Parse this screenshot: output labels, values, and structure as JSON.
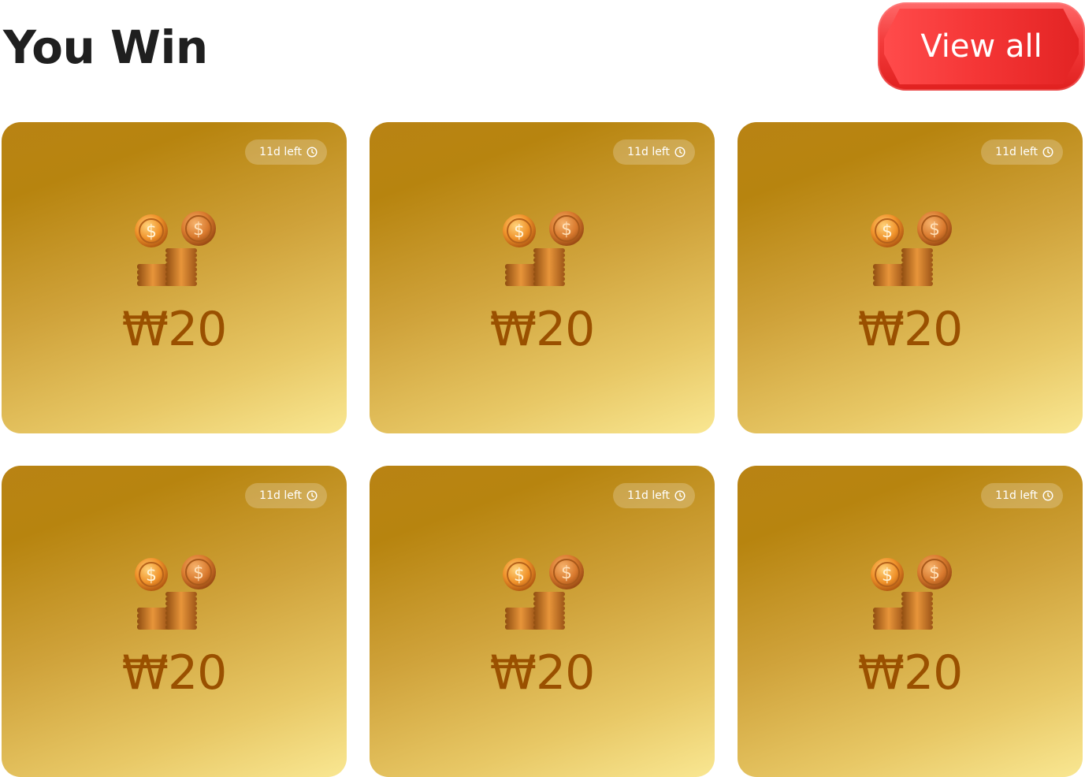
{
  "header": {
    "title": "You Win",
    "view_all_label": "View all"
  },
  "rewards": [
    {
      "amount": "₩20",
      "time_left": "11d left",
      "icon": "coins-icon"
    },
    {
      "amount": "₩20",
      "time_left": "11d left",
      "icon": "coins-icon"
    },
    {
      "amount": "₩20",
      "time_left": "11d left",
      "icon": "coins-icon"
    },
    {
      "amount": "₩20",
      "time_left": "11d left",
      "icon": "coins-icon"
    },
    {
      "amount": "₩20",
      "time_left": "11d left",
      "icon": "coins-icon"
    },
    {
      "amount": "₩20",
      "time_left": "11d left",
      "icon": "coins-icon"
    }
  ],
  "colors": {
    "accent_red": "#f33b3b",
    "card_gold_dark": "#b98314",
    "card_gold_light": "#f9e792",
    "amount_text": "#9a5000",
    "title_text": "#1f1f1f"
  }
}
